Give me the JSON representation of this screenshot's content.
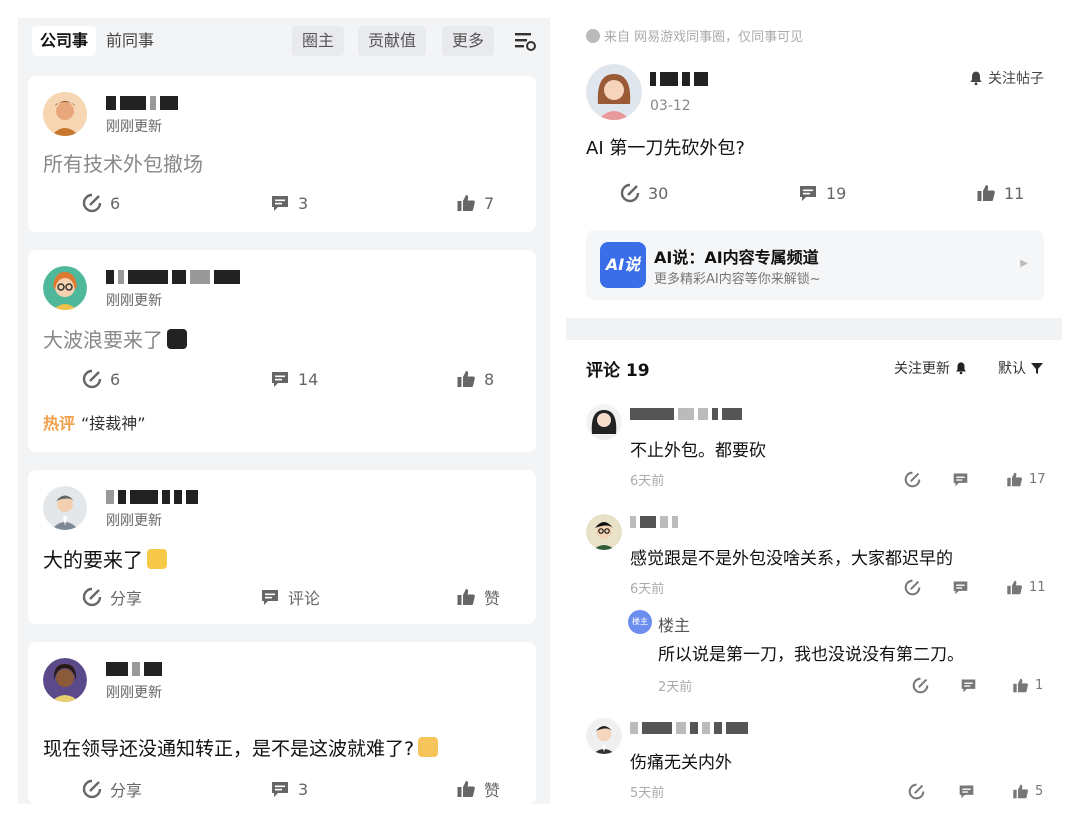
{
  "left": {
    "tabs": [
      "公司事",
      "前同事",
      "圈主",
      "贡献值",
      "更多"
    ],
    "posts": [
      {
        "status": "刚刚更新",
        "title": "所有技术外包撤场",
        "share": "6",
        "comment": "3",
        "like": "7"
      },
      {
        "status": "刚刚更新",
        "title": "大波浪要来了",
        "share": "6",
        "comment": "14",
        "like": "8",
        "hot_label": "热评",
        "hot_text": "“接裁神”"
      },
      {
        "status": "刚刚更新",
        "title": "大的要来了",
        "share": "分享",
        "comment": "评论",
        "like": "赞"
      },
      {
        "status": "刚刚更新",
        "title": "现在领导还没通知转正，是不是这波就难了?",
        "share": "分享",
        "comment": "3",
        "like": "赞"
      }
    ]
  },
  "right": {
    "source": "来自 网易游戏同事圈，仅同事可见",
    "op_date": "03-12",
    "follow_post": "关注帖子",
    "op_title": "AI 第一刀先砍外包?",
    "op_share": "30",
    "op_comment": "19",
    "op_like": "11",
    "ai_logo": "AI说",
    "ai_title": "AI说：AI内容专属频道",
    "ai_sub": "更多精彩AI内容等你来解锁~",
    "comments_title": "评论 19",
    "follow_update": "关注更新",
    "sort_default": "默认",
    "comments": [
      {
        "text": "不止外包。都要砍",
        "time": "6天前",
        "like": "17"
      },
      {
        "text": "感觉跟是不是外包没啥关系，大家都迟早的",
        "time": "6天前",
        "like": "11"
      },
      {
        "text": "伤痛无关内外",
        "time": "5天前",
        "like": "5"
      }
    ],
    "reply": {
      "badge": "楼主",
      "name": "楼主",
      "text": "所以说是第一刀，我也没说没有第二刀。",
      "time": "2天前",
      "like": "1"
    }
  },
  "colors": {
    "accent_blue": "#3a6de8",
    "hot_orange": "#f0a04b",
    "panel_bg": "#f3f4f6"
  }
}
